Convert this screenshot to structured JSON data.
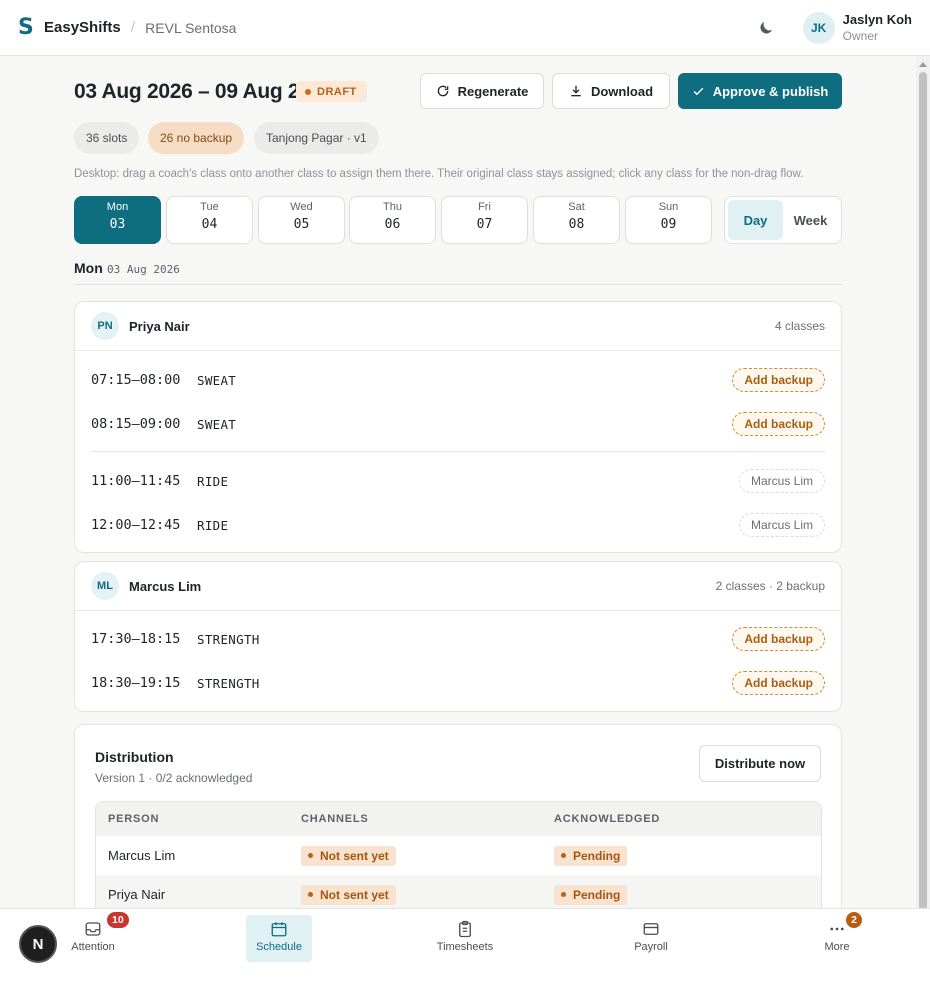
{
  "app": {
    "brand": "EasyShifts",
    "location": "REVL Sentosa"
  },
  "user": {
    "initials": "JK",
    "name": "Jaslyn Koh",
    "role": "Owner"
  },
  "header": {
    "title": "03 Aug 2026 – 09 Aug 2026",
    "status": "DRAFT",
    "regenerate": "Regenerate",
    "download": "Download",
    "approve": "Approve & publish"
  },
  "chips": {
    "slots": "36 slots",
    "no_backup": "26 no backup",
    "version": "Tanjong Pagar · v1"
  },
  "hint": "Desktop: drag a coach's class onto another class to assign them there. Their original class stays assigned; click any class for the non-drag flow.",
  "days": [
    {
      "name": "Mon",
      "date": "03",
      "active": true
    },
    {
      "name": "Tue",
      "date": "04"
    },
    {
      "name": "Wed",
      "date": "05"
    },
    {
      "name": "Thu",
      "date": "06"
    },
    {
      "name": "Fri",
      "date": "07"
    },
    {
      "name": "Sat",
      "date": "08"
    },
    {
      "name": "Sun",
      "date": "09"
    }
  ],
  "view": {
    "day": "Day",
    "week": "Week",
    "selected": "Day"
  },
  "current_day": {
    "label": "Mon",
    "date": "03 Aug 2026"
  },
  "coaches": [
    {
      "initials": "PN",
      "name": "Priya Nair",
      "meta": "4 classes",
      "classes": [
        {
          "time": "07:15–08:00",
          "name": "SWEAT",
          "action": "Add backup"
        },
        {
          "time": "08:15–09:00",
          "name": "SWEAT",
          "action": "Add backup"
        },
        {
          "time": "11:00–11:45",
          "name": "RIDE",
          "backup": "Marcus Lim"
        },
        {
          "time": "12:00–12:45",
          "name": "RIDE",
          "backup": "Marcus Lim"
        }
      ]
    },
    {
      "initials": "ML",
      "name": "Marcus Lim",
      "meta": "2 classes · 2 backup",
      "classes": [
        {
          "time": "17:30–18:15",
          "name": "STRENGTH",
          "action": "Add backup"
        },
        {
          "time": "18:30–19:15",
          "name": "STRENGTH",
          "action": "Add backup"
        }
      ]
    }
  ],
  "distribution": {
    "title": "Distribution",
    "subtitle": "Version 1 · 0/2 acknowledged",
    "button": "Distribute now",
    "columns": [
      "PERSON",
      "CHANNELS",
      "ACKNOWLEDGED"
    ],
    "rows": [
      {
        "person": "Marcus Lim",
        "channel": "Not sent yet",
        "ack": "Pending"
      },
      {
        "person": "Priya Nair",
        "channel": "Not sent yet",
        "ack": "Pending"
      }
    ]
  },
  "nav": {
    "items": [
      {
        "label": "Attention",
        "icon": "inbox-icon",
        "badge": "10"
      },
      {
        "label": "Schedule",
        "icon": "calendar-icon",
        "active": true
      },
      {
        "label": "Timesheets",
        "icon": "clipboard-icon"
      },
      {
        "label": "Payroll",
        "icon": "wallet-icon"
      },
      {
        "label": "More",
        "icon": "more-icon",
        "badge": "2"
      }
    ],
    "dev_badge": "N"
  },
  "colors": {
    "accent": "#0e6e80",
    "warning": "#b4621a",
    "danger": "#c8362f"
  }
}
